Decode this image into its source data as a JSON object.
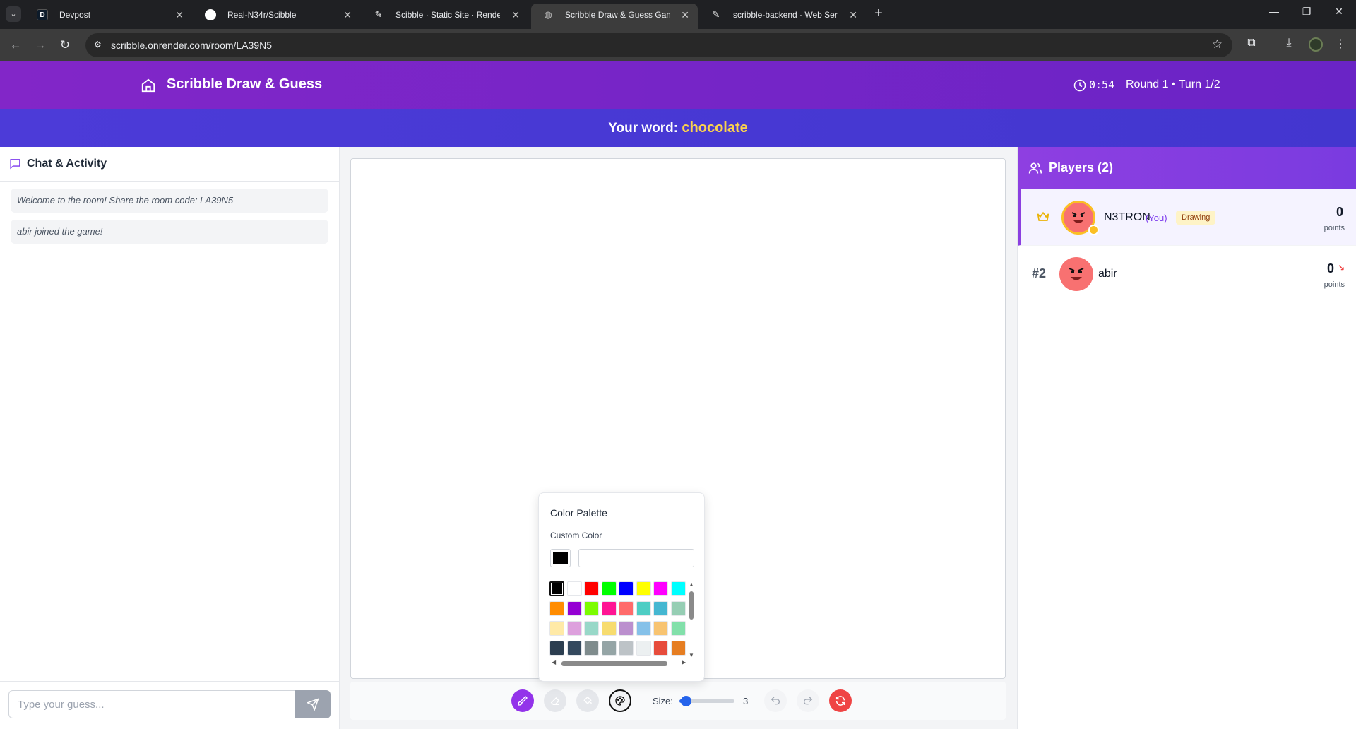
{
  "browser": {
    "tabs": [
      {
        "title": "Devpost",
        "fav_letter": "D"
      },
      {
        "title": "Real-N34r/Scibble",
        "fav_letter": ""
      },
      {
        "title": "Scibble · Static Site · Render D",
        "fav_letter": ""
      },
      {
        "title": "Scribble Draw & Guess Game",
        "fav_letter": ""
      },
      {
        "title": "scribble-backend · Web Service",
        "fav_letter": ""
      }
    ],
    "url": "scribble.onrender.com/room/LA39N5"
  },
  "header": {
    "title": "Scribble Draw & Guess",
    "timer": "0:54",
    "round": "Round 1 • Turn 1/2"
  },
  "word_bar": {
    "prefix": "Your word:",
    "word": "chocolate"
  },
  "chat": {
    "title": "Chat & Activity",
    "messages": [
      "Welcome to the room! Share the room code: LA39N5",
      "abir joined the game!"
    ],
    "input_placeholder": "Type your guess..."
  },
  "toolbar": {
    "size_label": "Size:",
    "size_value": "3"
  },
  "palette": {
    "title": "Color Palette",
    "custom_label": "Custom Color",
    "custom_value": "",
    "colors": [
      "#000000",
      "#ffffff",
      "#ff0000",
      "#00ff00",
      "#0000ff",
      "#ffff00",
      "#ff00ff",
      "#00ffff",
      "#ff8c00",
      "#9400d3",
      "#7cfc00",
      "#ff1493",
      "#ff6b6b",
      "#4ecdc4",
      "#45b7d1",
      "#96ceb4",
      "#ffeaa7",
      "#dda0dd",
      "#98d8c8",
      "#f7dc6f",
      "#bb8fce",
      "#85c1e9",
      "#f8c471",
      "#82e0aa",
      "#2c3e50",
      "#34495e",
      "#7f8c8d",
      "#95a5a6",
      "#bdc3c7",
      "#ecf0f1",
      "#e74c3c",
      "#e67e22"
    ],
    "selected": "#000000"
  },
  "players": {
    "title": "Players (2)",
    "list": [
      {
        "name": "N3TRON",
        "you_label": "(You)",
        "status": "Drawing",
        "score": "0",
        "points_label": "points",
        "rank": ""
      },
      {
        "name": "abir",
        "you_label": "",
        "status": "",
        "score": "0",
        "points_label": "points",
        "rank": "#2"
      }
    ]
  },
  "colors": {
    "header_purple": "#7b22c9",
    "word_bar_indigo": "#4a3ad6",
    "word_highlight": "#fcd34d",
    "brush_active": "#9333ea",
    "clear_red": "#ef4444"
  }
}
